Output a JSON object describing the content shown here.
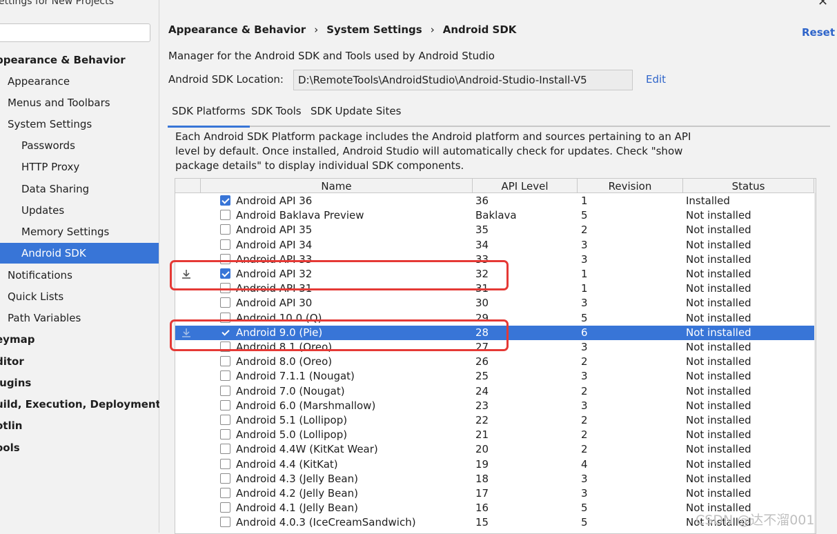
{
  "window": {
    "title": "ettings for New Projects",
    "close": "✕"
  },
  "sidebar": {
    "items": [
      {
        "label": "ppearance & Behavior",
        "level": 0,
        "selected": false
      },
      {
        "label": "Appearance",
        "level": 1,
        "selected": false
      },
      {
        "label": "Menus and Toolbars",
        "level": 1,
        "selected": false
      },
      {
        "label": "System Settings",
        "level": 1,
        "selected": false
      },
      {
        "label": "Passwords",
        "level": 2,
        "selected": false
      },
      {
        "label": "HTTP Proxy",
        "level": 2,
        "selected": false
      },
      {
        "label": "Data Sharing",
        "level": 2,
        "selected": false
      },
      {
        "label": "Updates",
        "level": 2,
        "selected": false
      },
      {
        "label": "Memory Settings",
        "level": 2,
        "selected": false
      },
      {
        "label": "Android SDK",
        "level": 2,
        "selected": true
      },
      {
        "label": "Notifications",
        "level": 1,
        "selected": false
      },
      {
        "label": "Quick Lists",
        "level": 1,
        "selected": false
      },
      {
        "label": "Path Variables",
        "level": 1,
        "selected": false
      },
      {
        "label": "eymap",
        "level": 0,
        "selected": false
      },
      {
        "label": "ditor",
        "level": 0,
        "selected": false
      },
      {
        "label": "lugins",
        "level": 0,
        "selected": false
      },
      {
        "label": "uild, Execution, Deployment",
        "level": 0,
        "selected": false
      },
      {
        "label": "otlin",
        "level": 0,
        "selected": false
      },
      {
        "label": "ools",
        "level": 0,
        "selected": false
      }
    ]
  },
  "header": {
    "breadcrumb": [
      "Appearance & Behavior",
      "System Settings",
      "Android SDK"
    ],
    "separator": "›",
    "reset": "Reset"
  },
  "main": {
    "description": "Manager for the Android SDK and Tools used by Android Studio",
    "location_label": "Android SDK Location:",
    "location_value": "D:\\RemoteTools\\AndroidStudio\\Android-Studio-Install-V5",
    "edit": "Edit",
    "tabs": [
      {
        "label": "SDK Platforms",
        "active": true
      },
      {
        "label": "SDK Tools",
        "active": false
      },
      {
        "label": "SDK Update Sites",
        "active": false
      }
    ],
    "info": "Each Android SDK Platform package includes the Android platform and sources pertaining to an API level by default. Once installed, Android Studio will automatically check for updates. Check \"show package details\" to display individual SDK components."
  },
  "table": {
    "columns": [
      "Name",
      "API Level",
      "Revision",
      "Status"
    ],
    "rows": [
      {
        "name": "Android API 36",
        "api": "36",
        "rev": "1",
        "status": "Installed",
        "checked": true,
        "download": false,
        "selected": false
      },
      {
        "name": "Android Baklava Preview",
        "api": "Baklava",
        "rev": "5",
        "status": "Not installed",
        "checked": false,
        "download": false,
        "selected": false
      },
      {
        "name": "Android API 35",
        "api": "35",
        "rev": "2",
        "status": "Not installed",
        "checked": false,
        "download": false,
        "selected": false
      },
      {
        "name": "Android API 34",
        "api": "34",
        "rev": "3",
        "status": "Not installed",
        "checked": false,
        "download": false,
        "selected": false
      },
      {
        "name": "Android API 33",
        "api": "33",
        "rev": "3",
        "status": "Not installed",
        "checked": false,
        "download": false,
        "selected": false
      },
      {
        "name": "Android API 32",
        "api": "32",
        "rev": "1",
        "status": "Not installed",
        "checked": true,
        "download": true,
        "selected": false
      },
      {
        "name": "Android API 31",
        "api": "31",
        "rev": "1",
        "status": "Not installed",
        "checked": false,
        "download": false,
        "selected": false
      },
      {
        "name": "Android API 30",
        "api": "30",
        "rev": "3",
        "status": "Not installed",
        "checked": false,
        "download": false,
        "selected": false
      },
      {
        "name": "Android 10.0 (Q)",
        "api": "29",
        "rev": "5",
        "status": "Not installed",
        "checked": false,
        "download": false,
        "selected": false
      },
      {
        "name": "Android 9.0 (Pie)",
        "api": "28",
        "rev": "6",
        "status": "Not installed",
        "checked": true,
        "download": true,
        "selected": true
      },
      {
        "name": "Android 8.1 (Oreo)",
        "api": "27",
        "rev": "3",
        "status": "Not installed",
        "checked": false,
        "download": false,
        "selected": false
      },
      {
        "name": "Android 8.0 (Oreo)",
        "api": "26",
        "rev": "2",
        "status": "Not installed",
        "checked": false,
        "download": false,
        "selected": false
      },
      {
        "name": "Android 7.1.1 (Nougat)",
        "api": "25",
        "rev": "3",
        "status": "Not installed",
        "checked": false,
        "download": false,
        "selected": false
      },
      {
        "name": "Android 7.0 (Nougat)",
        "api": "24",
        "rev": "2",
        "status": "Not installed",
        "checked": false,
        "download": false,
        "selected": false
      },
      {
        "name": "Android 6.0 (Marshmallow)",
        "api": "23",
        "rev": "3",
        "status": "Not installed",
        "checked": false,
        "download": false,
        "selected": false
      },
      {
        "name": "Android 5.1 (Lollipop)",
        "api": "22",
        "rev": "2",
        "status": "Not installed",
        "checked": false,
        "download": false,
        "selected": false
      },
      {
        "name": "Android 5.0 (Lollipop)",
        "api": "21",
        "rev": "2",
        "status": "Not installed",
        "checked": false,
        "download": false,
        "selected": false
      },
      {
        "name": "Android 4.4W (KitKat Wear)",
        "api": "20",
        "rev": "2",
        "status": "Not installed",
        "checked": false,
        "download": false,
        "selected": false
      },
      {
        "name": "Android 4.4 (KitKat)",
        "api": "19",
        "rev": "4",
        "status": "Not installed",
        "checked": false,
        "download": false,
        "selected": false
      },
      {
        "name": "Android 4.3 (Jelly Bean)",
        "api": "18",
        "rev": "3",
        "status": "Not installed",
        "checked": false,
        "download": false,
        "selected": false
      },
      {
        "name": "Android 4.2 (Jelly Bean)",
        "api": "17",
        "rev": "3",
        "status": "Not installed",
        "checked": false,
        "download": false,
        "selected": false
      },
      {
        "name": "Android 4.1 (Jelly Bean)",
        "api": "16",
        "rev": "5",
        "status": "Not installed",
        "checked": false,
        "download": false,
        "selected": false
      },
      {
        "name": "Android 4.0.3 (IceCreamSandwich)",
        "api": "15",
        "rev": "5",
        "status": "Not installed",
        "checked": false,
        "download": false,
        "selected": false
      }
    ]
  },
  "watermark": "CSDN @达不溜001",
  "colors": {
    "accent": "#3875d7",
    "highlight": "#e53935",
    "link": "#2f65ca"
  },
  "icons": {
    "download": "download-icon",
    "close": "close-icon"
  }
}
